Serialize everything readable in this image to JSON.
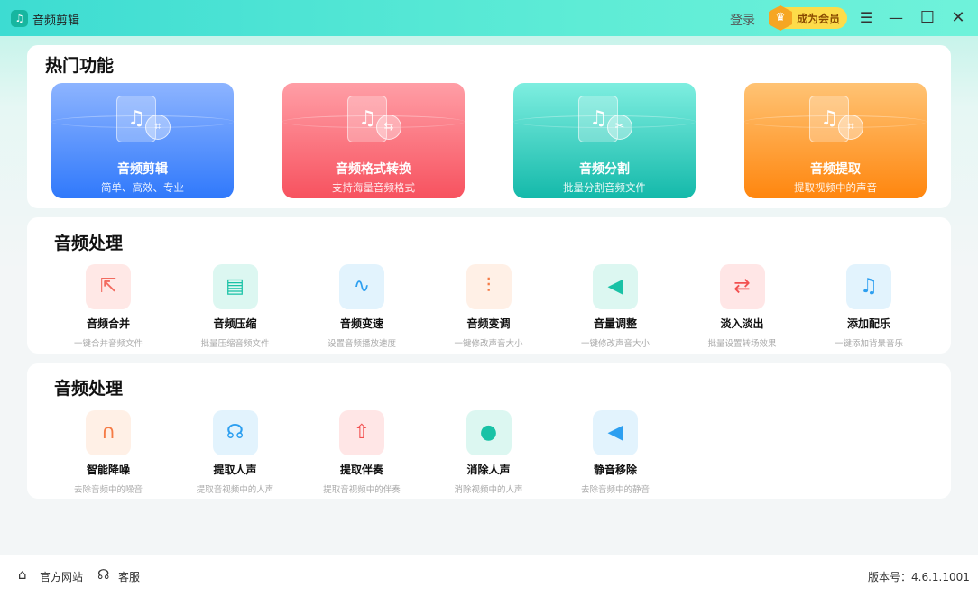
{
  "app": {
    "title": "音频剪辑",
    "login": "登录",
    "vip": "成为会员"
  },
  "hot": {
    "title": "热门功能",
    "cards": [
      {
        "name": "音频剪辑",
        "desc": "简单、高效、专业",
        "icon": "crop-icon",
        "colors": [
          "#8db4ff",
          "#3079fb"
        ]
      },
      {
        "name": "音频格式转换",
        "desc": "支持海量音频格式",
        "icon": "convert-icon",
        "colors": [
          "#ff9ea6",
          "#f7525f"
        ]
      },
      {
        "name": "音频分割",
        "desc": "批量分割音频文件",
        "icon": "scissors-icon",
        "colors": [
          "#7eeee0",
          "#14b9aa"
        ]
      },
      {
        "name": "音频提取",
        "desc": "提取视频中的声音",
        "icon": "extract-icon",
        "colors": [
          "#ffc374",
          "#ff860e"
        ]
      }
    ]
  },
  "proc1": {
    "title": "音频处理",
    "items": [
      {
        "name": "音频合并",
        "desc": "一键合并音频文件",
        "bg": "#ffe8e6",
        "fg": "#f26b5f",
        "glyph": "⇱"
      },
      {
        "name": "音频压缩",
        "desc": "批量压缩音频文件",
        "bg": "#dcf7f1",
        "fg": "#19c2a6",
        "glyph": "▤"
      },
      {
        "name": "音频变速",
        "desc": "设置音频播放速度",
        "bg": "#e2f3fd",
        "fg": "#2d9ff0",
        "glyph": "∿"
      },
      {
        "name": "音频变调",
        "desc": "一键修改声音大小",
        "bg": "#fff0e6",
        "fg": "#f57b45",
        "glyph": "⫶"
      },
      {
        "name": "音量调整",
        "desc": "一键修改声音大小",
        "bg": "#dcf7f1",
        "fg": "#19c2a6",
        "glyph": "◀"
      },
      {
        "name": "淡入淡出",
        "desc": "批量设置转场效果",
        "bg": "#ffe6e6",
        "fg": "#f25050",
        "glyph": "⇄"
      },
      {
        "name": "添加配乐",
        "desc": "一键添加背景音乐",
        "bg": "#e2f3fd",
        "fg": "#2d9ff0",
        "glyph": "♫"
      }
    ]
  },
  "proc2": {
    "title": "音频处理",
    "items": [
      {
        "name": "智能降噪",
        "desc": "去除音频中的噪音",
        "bg": "#fff0e6",
        "fg": "#f57b45",
        "glyph": "∩"
      },
      {
        "name": "提取人声",
        "desc": "提取音视频中的人声",
        "bg": "#e2f3fd",
        "fg": "#2d9ff0",
        "glyph": "☊"
      },
      {
        "name": "提取伴奏",
        "desc": "提取音视频中的伴奏",
        "bg": "#ffe6e6",
        "fg": "#f25050",
        "glyph": "⇧"
      },
      {
        "name": "消除人声",
        "desc": "消除视频中的人声",
        "bg": "#dcf7f1",
        "fg": "#19c2a6",
        "glyph": "●"
      },
      {
        "name": "静音移除",
        "desc": "去除音频中的静音",
        "bg": "#e2f3fd",
        "fg": "#2d9ff0",
        "glyph": "◀"
      }
    ]
  },
  "footer": {
    "website": "官方网站",
    "service": "客服",
    "version": "版本号：4.6.1.1001"
  }
}
